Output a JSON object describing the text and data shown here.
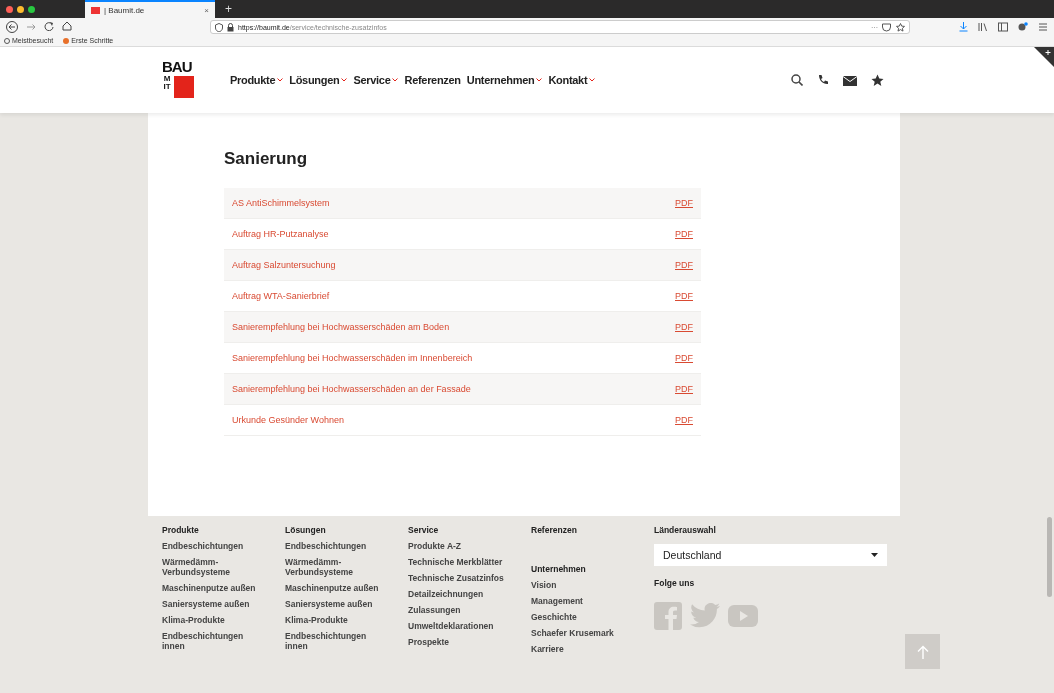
{
  "browser": {
    "tab_title": "| Baumit.de",
    "tab_close": "×",
    "new_tab": "+",
    "url_host": "https://baumit.de",
    "url_path": "/service/technische-zusatzinfos",
    "url_extra": "···",
    "bookmarks": [
      "Meistbesucht",
      "Erste Schritte"
    ]
  },
  "header": {
    "logo_top": "BAU",
    "logo_side": "MIT",
    "nav": [
      {
        "label": "Produkte",
        "dropdown": true
      },
      {
        "label": "Lösungen",
        "dropdown": true
      },
      {
        "label": "Service",
        "dropdown": true
      },
      {
        "label": "Referenzen",
        "dropdown": false
      },
      {
        "label": "Unternehmen",
        "dropdown": true
      },
      {
        "label": "Kontakt",
        "dropdown": true
      }
    ]
  },
  "section": {
    "title": "Sanierung",
    "documents": [
      {
        "name": "AS AntiSchimmelsystem",
        "link": "PDF"
      },
      {
        "name": "Auftrag HR-Putzanalyse",
        "link": "PDF"
      },
      {
        "name": "Auftrag Salzuntersuchung",
        "link": "PDF"
      },
      {
        "name": "Auftrag WTA-Sanierbrief",
        "link": "PDF"
      },
      {
        "name": "Sanierempfehlung bei Hochwasserschäden am Boden",
        "link": "PDF"
      },
      {
        "name": "Sanierempfehlung bei Hochwasserschäden im Innenbereich",
        "link": "PDF"
      },
      {
        "name": "Sanierempfehlung bei Hochwasserschäden an der Fassade",
        "link": "PDF"
      },
      {
        "name": "Urkunde Gesünder Wohnen",
        "link": "PDF"
      }
    ]
  },
  "footer": {
    "columns": [
      {
        "groups": [
          {
            "heading": "Produkte",
            "links": [
              "Endbeschichtungen",
              "Wärmedämm-Verbundsysteme",
              "Maschinenputze außen",
              "Saniersysteme außen",
              "Klima-Produkte",
              "Endbeschichtungen innen"
            ]
          }
        ]
      },
      {
        "groups": [
          {
            "heading": "Lösungen",
            "links": [
              "Endbeschichtungen",
              "Wärmedämm-Verbundsysteme",
              "Maschinenputze außen",
              "Saniersysteme außen",
              "Klima-Produkte",
              "Endbeschichtungen innen"
            ]
          }
        ]
      },
      {
        "groups": [
          {
            "heading": "Service",
            "links": [
              "Produkte A-Z",
              "Technische Merkblätter",
              "Technische Zusatzinfos",
              "Detailzeichnungen",
              "Zulassungen",
              "Umweltdeklarationen",
              "Prospekte"
            ]
          }
        ]
      },
      {
        "groups": [
          {
            "heading": "Referenzen"
          },
          {
            "heading": "Unternehmen",
            "links": [
              "Vision",
              "Management",
              "Geschichte",
              "Schaefer Krusemark",
              "Karriere"
            ]
          }
        ]
      }
    ],
    "country_label": "Länderauswahl",
    "country_value": "Deutschland",
    "follow_label": "Folge uns"
  }
}
